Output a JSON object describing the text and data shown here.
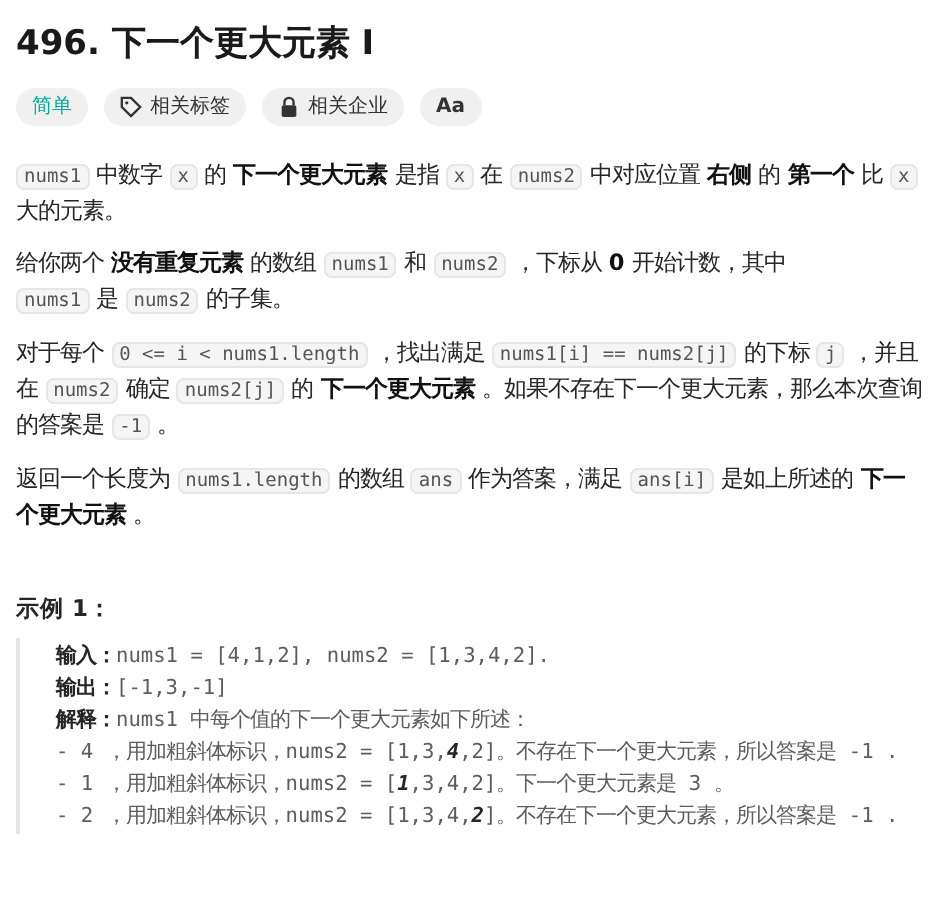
{
  "title": "496. 下一个更大元素 I",
  "tags": [
    {
      "kind": "difficulty",
      "label": "简单"
    },
    {
      "kind": "tag",
      "label": "相关标签"
    },
    {
      "kind": "lock",
      "label": "相关企业"
    },
    {
      "kind": "font",
      "label": "Aa"
    }
  ],
  "paragraphs": [
    [
      {
        "kind": "code",
        "text": "nums1"
      },
      {
        "kind": "text",
        "text": " 中数字 "
      },
      {
        "kind": "code",
        "text": "x"
      },
      {
        "kind": "text",
        "text": " 的 "
      },
      {
        "kind": "bold",
        "text": "下一个更大元素"
      },
      {
        "kind": "text",
        "text": " 是指 "
      },
      {
        "kind": "code",
        "text": "x"
      },
      {
        "kind": "text",
        "text": " 在 "
      },
      {
        "kind": "code",
        "text": "nums2"
      },
      {
        "kind": "text",
        "text": " 中对应位置 "
      },
      {
        "kind": "bold",
        "text": "右侧"
      },
      {
        "kind": "text",
        "text": " 的 "
      },
      {
        "kind": "bold",
        "text": "第一个"
      },
      {
        "kind": "text",
        "text": " 比 "
      },
      {
        "kind": "code",
        "text": "x"
      },
      {
        "kind": "text",
        "text": " 大的元素。"
      }
    ],
    [
      {
        "kind": "text",
        "text": "给你两个 "
      },
      {
        "kind": "bold",
        "text": "没有重复元素"
      },
      {
        "kind": "text",
        "text": " 的数组 "
      },
      {
        "kind": "code",
        "text": "nums1"
      },
      {
        "kind": "text",
        "text": " 和 "
      },
      {
        "kind": "code",
        "text": "nums2"
      },
      {
        "kind": "text",
        "text": " ，下标从 "
      },
      {
        "kind": "bold",
        "text": "0"
      },
      {
        "kind": "text",
        "text": " 开始计数，其中"
      },
      {
        "kind": "break"
      },
      {
        "kind": "code",
        "text": "nums1"
      },
      {
        "kind": "text",
        "text": " 是 "
      },
      {
        "kind": "code",
        "text": "nums2"
      },
      {
        "kind": "text",
        "text": " 的子集。"
      }
    ],
    [
      {
        "kind": "text",
        "text": "对于每个 "
      },
      {
        "kind": "code",
        "text": "0 <= i < nums1.length"
      },
      {
        "kind": "text",
        "text": " ，找出满足 "
      },
      {
        "kind": "code",
        "text": "nums1[i] == nums2[j]"
      },
      {
        "kind": "text",
        "text": " 的下标 "
      },
      {
        "kind": "code",
        "text": "j"
      },
      {
        "kind": "text",
        "text": " ，并且在 "
      },
      {
        "kind": "code",
        "text": "nums2"
      },
      {
        "kind": "text",
        "text": " 确定 "
      },
      {
        "kind": "code",
        "text": "nums2[j]"
      },
      {
        "kind": "text",
        "text": " 的 "
      },
      {
        "kind": "bold",
        "text": "下一个更大元素"
      },
      {
        "kind": "text",
        "text": " 。如果不存在下一个更大元素，那么本次查询的答案是 "
      },
      {
        "kind": "code",
        "text": "-1"
      },
      {
        "kind": "text",
        "text": " 。"
      }
    ],
    [
      {
        "kind": "text",
        "text": "返回一个长度为 "
      },
      {
        "kind": "code",
        "text": "nums1.length"
      },
      {
        "kind": "text",
        "text": " 的数组 "
      },
      {
        "kind": "code",
        "text": "ans"
      },
      {
        "kind": "text",
        "text": " 作为答案，满足 "
      },
      {
        "kind": "code",
        "text": "ans[i]"
      },
      {
        "kind": "text",
        "text": " 是如上所述的 "
      },
      {
        "kind": "bold",
        "text": "下一个更大元素"
      },
      {
        "kind": "text",
        "text": " 。"
      }
    ]
  ],
  "example": {
    "heading": "示例 1：",
    "lines": [
      [
        {
          "kind": "label",
          "text": "输入："
        },
        {
          "kind": "text",
          "text": "nums1 = [4,1,2], nums2 = [1,3,4,2]."
        }
      ],
      [
        {
          "kind": "label",
          "text": "输出："
        },
        {
          "kind": "text",
          "text": "[-1,3,-1]"
        }
      ],
      [
        {
          "kind": "label",
          "text": "解释："
        },
        {
          "kind": "text",
          "text": "nums1 中每个值的下一个更大元素如下所述："
        }
      ],
      [
        {
          "kind": "text",
          "text": "- 4 ，用加粗斜体标识，nums2 = [1,3,"
        },
        {
          "kind": "emph",
          "text": "4"
        },
        {
          "kind": "text",
          "text": ",2]。不存在下一个更大元素，所以答案是 -1 ."
        }
      ],
      [
        {
          "kind": "text",
          "text": "- 1 ，用加粗斜体标识，nums2 = ["
        },
        {
          "kind": "emph",
          "text": "1"
        },
        {
          "kind": "text",
          "text": ",3,4,2]。下一个更大元素是 3 。"
        }
      ],
      [
        {
          "kind": "text",
          "text": "- 2 ，用加粗斜体标识，nums2 = [1,3,4,"
        },
        {
          "kind": "emph",
          "text": "2"
        },
        {
          "kind": "text",
          "text": "]。不存在下一个更大元素，所以答案是 -1 ."
        }
      ]
    ]
  }
}
